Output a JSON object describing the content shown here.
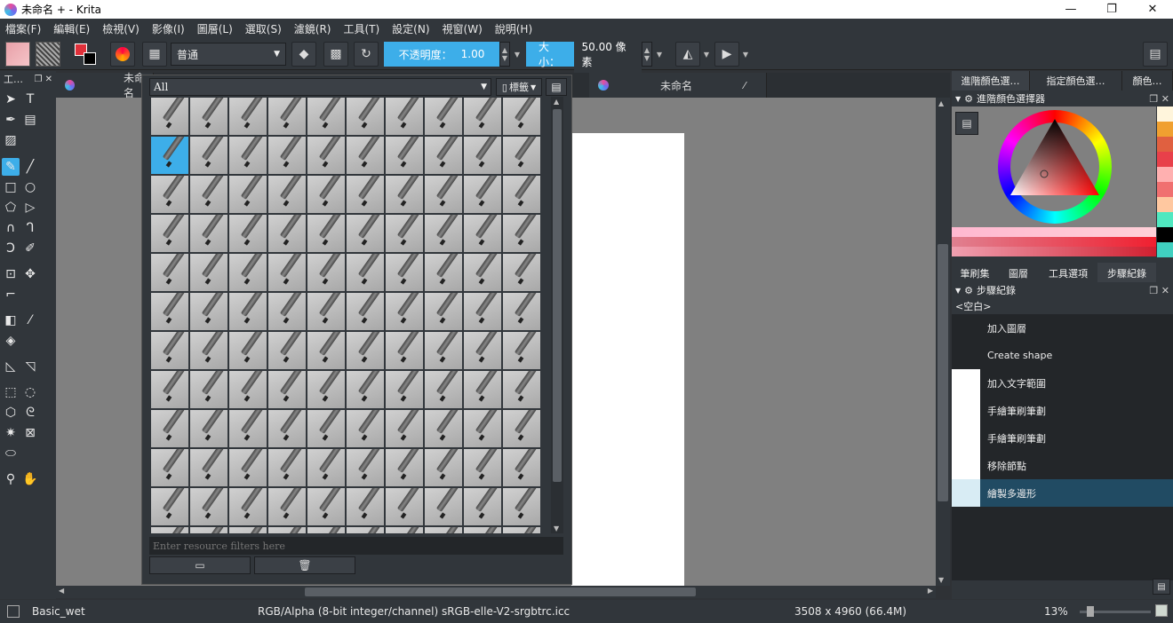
{
  "window": {
    "title": "未命名 + - Krita",
    "minimize": "—",
    "restore": "❐",
    "close": "✕"
  },
  "menu": [
    "檔案(F)",
    "編輯(E)",
    "檢視(V)",
    "影像(I)",
    "圖層(L)",
    "選取(S)",
    "濾鏡(R)",
    "工具(T)",
    "設定(N)",
    "視窗(W)",
    "說明(H)"
  ],
  "toolbar": {
    "blend_mode": "普通",
    "opacity_label": "不透明度：",
    "opacity_value": "1.00",
    "size_label": "大小：",
    "size_value": "50.00 像素"
  },
  "toolbox": {
    "title": "工…"
  },
  "document_tabs": [
    "未命名",
    "未命名"
  ],
  "brush_popup": {
    "filter_combo": "All",
    "tag_button": "標籤",
    "filter_placeholder": "Enter resource filters here",
    "selected_index": 10,
    "preset_count": 120
  },
  "right_dock": {
    "top_tabs": [
      "進階顏色選…",
      "指定顏色選…",
      "顏色…"
    ],
    "color_panel_title": "進階顏色選擇器",
    "swatch_colors": [
      "#fff5dc",
      "#f0a030",
      "#e06040",
      "#e8404a",
      "#ffb0b0",
      "#f07070",
      "#ffc8a0",
      "#50e8c0",
      "#000000",
      "#40d0c0"
    ],
    "lower_tabs": [
      "筆刷集",
      "圖層",
      "工具選項",
      "步驟紀錄"
    ],
    "history_title": "步驟紀錄",
    "history_empty": "<空白>",
    "history_items": [
      "加入圖層",
      "Create shape",
      "加入文字範圍",
      "手繪筆刷筆劃",
      "手繪筆刷筆劃",
      "移除節點",
      "繪製多邊形"
    ]
  },
  "status": {
    "brush": "Basic_wet",
    "color_info": "RGB/Alpha (8-bit integer/channel)  sRGB-elle-V2-srgbtrc.icc",
    "size": "3508 x 4960 (66.4M)",
    "zoom": "13%"
  },
  "colors": {
    "accent": "#3daee9",
    "panel": "#31363b",
    "canvas": "#808080",
    "fg": "#e0303a",
    "bg": "#000000"
  }
}
